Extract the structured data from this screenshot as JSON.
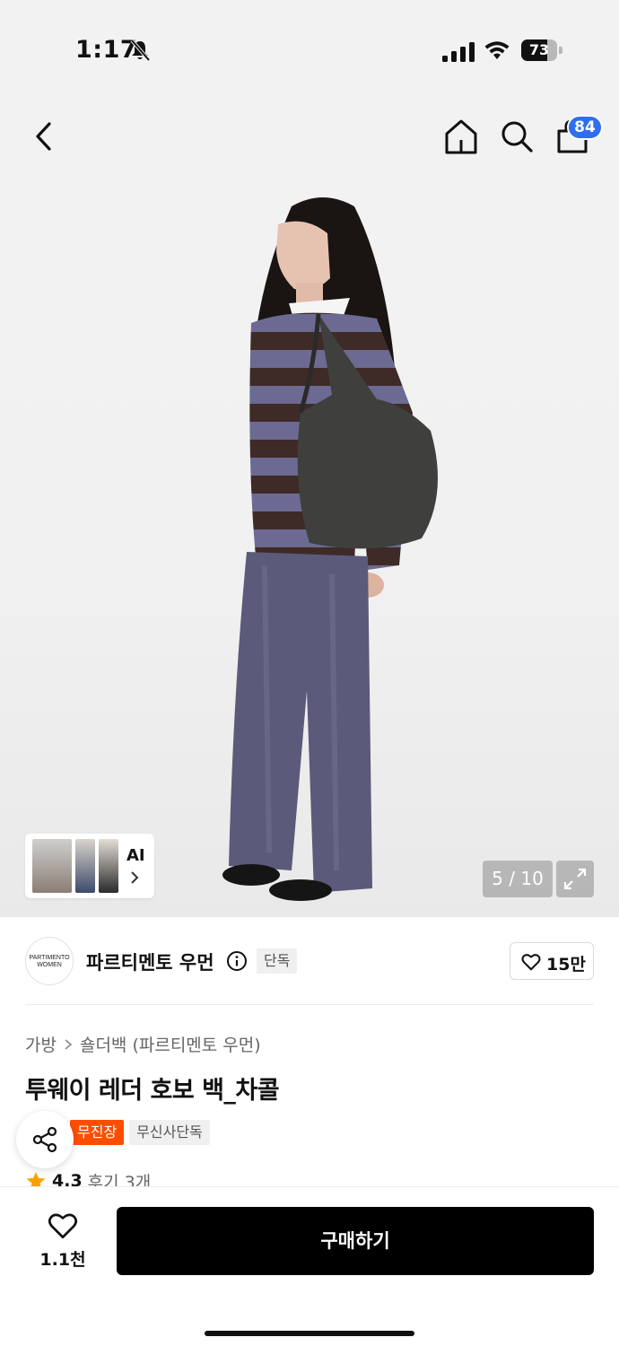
{
  "status_bar": {
    "time": "1:17",
    "battery": "73",
    "battery_level": 0.73,
    "icons": [
      "bell-slash-icon",
      "signal-icon",
      "wifi-icon",
      "battery-icon"
    ]
  },
  "nav": {
    "icons": [
      "back-icon",
      "home-icon",
      "search-icon",
      "cart-icon"
    ],
    "cart_badge": "84",
    "badge_color": "#2f6ef0"
  },
  "gallery": {
    "ai_label": "AI",
    "counter": "5 / 10",
    "current": 5,
    "total": 10
  },
  "brand": {
    "logo_text": "PARTIMENTO WOMEN",
    "name": "파르티멘토 우먼",
    "exclusive_tag": "단독",
    "like_count": "15만"
  },
  "product": {
    "breadcrumb": [
      "가방",
      "숄더백 (파르티멘토 우먼)"
    ],
    "title": "투웨이 레더 호보 백_차콜",
    "tags": [
      {
        "label": "무진장",
        "color": "#ff4d00"
      },
      {
        "label": "무신사단독",
        "color": "#f0f0f0"
      }
    ],
    "rating": "4.3",
    "review_label": "후기 3개",
    "star_color": "#f5a200"
  },
  "bottom_bar": {
    "wish_count": "1.1천",
    "buy_label": "구매하기"
  }
}
